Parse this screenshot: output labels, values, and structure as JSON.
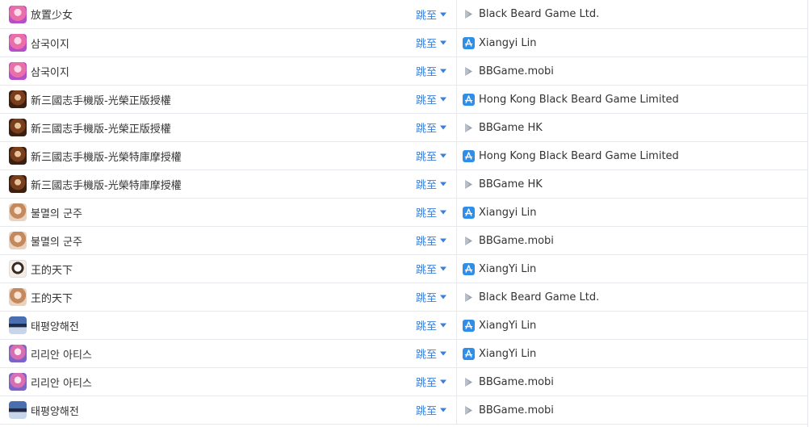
{
  "jump_label": "跳至",
  "rows": [
    {
      "game": "放置少女",
      "icon": "pink-anime-girl-icon",
      "store": "google-play-icon",
      "developer": "Black Beard Game Ltd."
    },
    {
      "game": "삼국이지",
      "icon": "pink-anime-girl-icon",
      "store": "app-store-icon",
      "developer": "Xiangyi Lin"
    },
    {
      "game": "삼국이지",
      "icon": "pink-anime-girl-icon",
      "store": "google-play-icon",
      "developer": "BBGame.mobi"
    },
    {
      "game": "新三國志手機版-光榮正版授權",
      "icon": "sango-warrior-icon",
      "store": "app-store-icon",
      "developer": "Hong Kong Black Beard Game Limited"
    },
    {
      "game": "新三國志手機版-光榮正版授權",
      "icon": "sango-warrior-icon",
      "store": "google-play-icon",
      "developer": "BBGame HK"
    },
    {
      "game": "新三國志手機版-光榮特庫摩授權",
      "icon": "sango-warrior-icon",
      "store": "app-store-icon",
      "developer": "Hong Kong Black Beard Game Limited"
    },
    {
      "game": "新三國志手機版-光榮特庫摩授權",
      "icon": "sango-warrior-icon",
      "store": "google-play-icon",
      "developer": "BBGame HK"
    },
    {
      "game": "불멸의 군주",
      "icon": "lady-portrait-icon",
      "store": "app-store-icon",
      "developer": "Xiangyi Lin"
    },
    {
      "game": "불멸의 군주",
      "icon": "lady-portrait-icon",
      "store": "google-play-icon",
      "developer": "BBGame.mobi"
    },
    {
      "game": "王的天下",
      "icon": "ink-calligraphy-icon",
      "store": "app-store-icon",
      "developer": "XiangYi Lin"
    },
    {
      "game": "王的天下",
      "icon": "lady-portrait-icon",
      "store": "google-play-icon",
      "developer": "Black Beard Game Ltd."
    },
    {
      "game": "태평양해전",
      "icon": "warship-icon",
      "store": "app-store-icon",
      "developer": "XiangYi Lin"
    },
    {
      "game": "리리안 아티스",
      "icon": "lilian-girl-icon",
      "store": "app-store-icon",
      "developer": "XiangYi Lin"
    },
    {
      "game": "리리안 아티스",
      "icon": "lilian-girl-icon",
      "store": "google-play-icon",
      "developer": "BBGame.mobi"
    },
    {
      "game": "태평양해전",
      "icon": "warship-icon",
      "store": "google-play-icon",
      "developer": "BBGame.mobi"
    }
  ],
  "colors": {
    "link_blue": "#3b7fd8",
    "app_store_blue": "#2f8ee8",
    "border": "#e6e9ee",
    "text": "#333333"
  }
}
